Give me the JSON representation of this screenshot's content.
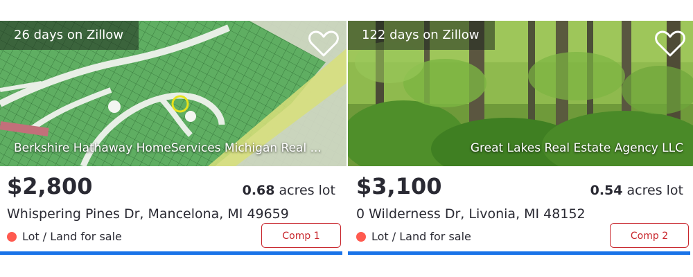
{
  "listings": [
    {
      "days_on_site": "26 days on Zillow",
      "broker": "Berkshire Hathaway HomeServices Michigan Real ...",
      "price": "$2,800",
      "lot_value": "0.68",
      "lot_unit": "acres lot",
      "address": "Whispering Pines Dr, Mancelona, MI 49659",
      "status": "Lot / Land for sale",
      "comp_label": "Comp 1",
      "photo_icon": "plat-map-image"
    },
    {
      "days_on_site": "122 days on Zillow",
      "broker": "Great Lakes Real Estate Agency LLC",
      "price": "$3,100",
      "lot_value": "0.54",
      "lot_unit": "acres lot",
      "address": "0 Wilderness Dr, Livonia, MI 48152",
      "status": "Lot / Land for sale",
      "comp_label": "Comp 2",
      "photo_icon": "forest-image"
    }
  ],
  "colors": {
    "status_dot": "#ff5a4f",
    "comp_border": "#c8262c",
    "underline_bar": "#1a73e8",
    "text": "#2a2a33"
  },
  "icons": {
    "favorite": "heart-icon"
  }
}
